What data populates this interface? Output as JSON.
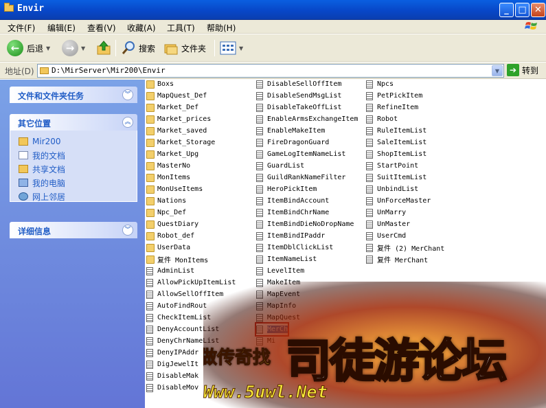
{
  "window": {
    "title": "Envir"
  },
  "menu": [
    "文件(F)",
    "编辑(E)",
    "查看(V)",
    "收藏(A)",
    "工具(T)",
    "帮助(H)"
  ],
  "toolbar": {
    "back": "后退",
    "search": "搜索",
    "folders": "文件夹"
  },
  "address": {
    "label": "地址(D)",
    "path": "D:\\MirServer\\Mir200\\Envir",
    "go": "转到"
  },
  "sidebar": {
    "tasks": {
      "title": "文件和文件夹任务"
    },
    "places": {
      "title": "其它位置",
      "items": [
        "Mir200",
        "我的文档",
        "共享文档",
        "我的电脑",
        "网上邻居"
      ]
    },
    "details": {
      "title": "详细信息"
    }
  },
  "files": {
    "col1": [
      {
        "name": "Boxs",
        "type": "folder"
      },
      {
        "name": "MapQuest_Def",
        "type": "folder"
      },
      {
        "name": "Market_Def",
        "type": "folder"
      },
      {
        "name": "Market_prices",
        "type": "folder"
      },
      {
        "name": "Market_saved",
        "type": "folder"
      },
      {
        "name": "Market_Storage",
        "type": "folder"
      },
      {
        "name": "Market_Upg",
        "type": "folder"
      },
      {
        "name": "MasterNo",
        "type": "folder"
      },
      {
        "name": "MonItems",
        "type": "folder"
      },
      {
        "name": "MonUseItems",
        "type": "folder"
      },
      {
        "name": "Nations",
        "type": "folder"
      },
      {
        "name": "Npc_Def",
        "type": "folder"
      },
      {
        "name": "QuestDiary",
        "type": "folder"
      },
      {
        "name": "Robot_def",
        "type": "folder"
      },
      {
        "name": "UserData",
        "type": "folder"
      },
      {
        "name": "复件 MonItems",
        "type": "folder"
      },
      {
        "name": "AdminList",
        "type": "file"
      },
      {
        "name": "AllowPickUpItemList",
        "type": "file"
      },
      {
        "name": "AllowSellOffItem",
        "type": "file"
      },
      {
        "name": "AutoFindRout",
        "type": "file"
      },
      {
        "name": "CheckItemList",
        "type": "file"
      },
      {
        "name": "DenyAccountList",
        "type": "file"
      },
      {
        "name": "DenyChrNameList",
        "type": "file"
      },
      {
        "name": "DenyIPAddr",
        "type": "file"
      },
      {
        "name": "DigJewelIt",
        "type": "file"
      },
      {
        "name": "DisableMak",
        "type": "file"
      },
      {
        "name": "DisableMov",
        "type": "file"
      }
    ],
    "col2": [
      {
        "name": "DisableSellOffItem",
        "type": "file"
      },
      {
        "name": "DisableSendMsgList",
        "type": "file"
      },
      {
        "name": "DisableTakeOffList",
        "type": "file"
      },
      {
        "name": "EnableArmsExchangeItem",
        "type": "file"
      },
      {
        "name": "EnableMakeItem",
        "type": "file"
      },
      {
        "name": "FireDragonGuard",
        "type": "file"
      },
      {
        "name": "GameLogItemNameList",
        "type": "file"
      },
      {
        "name": "GuardList",
        "type": "file"
      },
      {
        "name": "GuildRankNameFilter",
        "type": "file"
      },
      {
        "name": "HeroPickItem",
        "type": "file"
      },
      {
        "name": "ItemBindAccount",
        "type": "file"
      },
      {
        "name": "ItemBindChrName",
        "type": "file"
      },
      {
        "name": "ItemBindDieNoDropName",
        "type": "file"
      },
      {
        "name": "ItemBindIPaddr",
        "type": "file"
      },
      {
        "name": "ItemDblClickList",
        "type": "file"
      },
      {
        "name": "ItemNameList",
        "type": "file"
      },
      {
        "name": "LevelItem",
        "type": "file"
      },
      {
        "name": "MakeItem",
        "type": "file"
      },
      {
        "name": "MapEvent",
        "type": "file"
      },
      {
        "name": "MapInfo",
        "type": "file"
      },
      {
        "name": "MapQuest",
        "type": "file"
      },
      {
        "name": "MerCh",
        "type": "file",
        "selected": true
      },
      {
        "name": "Mi",
        "type": "file"
      }
    ],
    "col3": [
      {
        "name": "Npcs",
        "type": "file"
      },
      {
        "name": "PetPickItem",
        "type": "file"
      },
      {
        "name": "RefineItem",
        "type": "file"
      },
      {
        "name": "Robot",
        "type": "file"
      },
      {
        "name": "RuleItemList",
        "type": "file"
      },
      {
        "name": "SaleItemList",
        "type": "file"
      },
      {
        "name": "ShopItemList",
        "type": "file"
      },
      {
        "name": "StartPoint",
        "type": "file"
      },
      {
        "name": "SuitItemList",
        "type": "file"
      },
      {
        "name": "UnbindList",
        "type": "file"
      },
      {
        "name": "UnForceMaster",
        "type": "file"
      },
      {
        "name": "UnMarry",
        "type": "file"
      },
      {
        "name": "UnMaster",
        "type": "file"
      },
      {
        "name": "UserCmd",
        "type": "file"
      },
      {
        "name": "复件 (2) MerChant",
        "type": "file"
      },
      {
        "name": "复件 MerChant",
        "type": "file"
      }
    ]
  },
  "watermark": {
    "big": "司徒游论坛",
    "small": "做传奇找",
    "url": "Www.5uwl.Net"
  }
}
